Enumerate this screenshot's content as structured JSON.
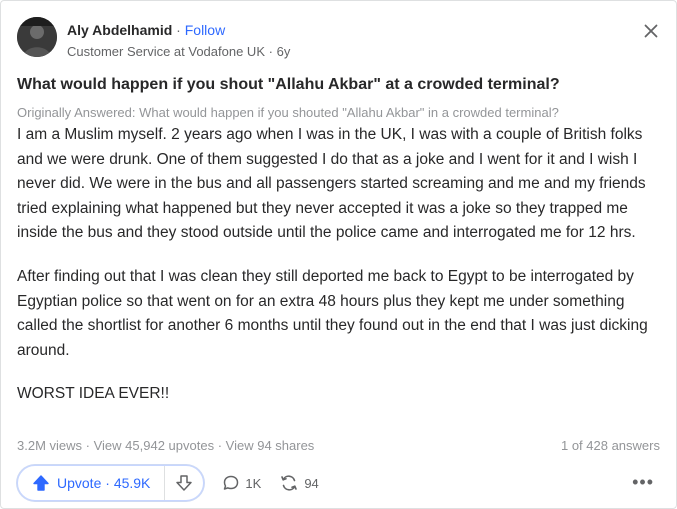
{
  "author": {
    "name": "Aly Abdelhamid",
    "separator": "·",
    "follow_label": "Follow",
    "credential": "Customer Service at Vodafone UK",
    "age": "6y"
  },
  "question": {
    "title": "What would happen if you shout \"Allahu Akbar\" at a crowded terminal?",
    "originally_answered": "Originally Answered: What would happen if you shouted \"Allahu Akbar\" in a crowded terminal?"
  },
  "answer": {
    "paragraphs": [
      "I am a Muslim myself. 2 years ago when I was in the UK, I was with a couple of British folks and we were drunk. One of them suggested I do that as a joke and I went for it and I wish I never did. We were in the bus and all passengers started screaming and me and my friends tried explaining what happened but they never accepted it was a joke so they trapped me inside the bus and they stood outside until the police came and interrogated me for 12 hrs.",
      "After finding out that I was clean they still deported me back to Egypt to be interrogated by Egyptian police so that went on for an extra 48 hours plus they kept me under something called the shortlist for another 6 months until they found out in the end that I was just dicking around.",
      "WORST IDEA EVER!!"
    ]
  },
  "stats": {
    "views": "3.2M views",
    "upvotes_link": "View 45,942 upvotes",
    "shares_link": "View 94 shares",
    "answer_position": "1 of 428 answers"
  },
  "actions": {
    "upvote_label": "Upvote",
    "upvote_count": "45.9K",
    "comments_count": "1K",
    "shares_count": "94"
  },
  "colors": {
    "accent": "#2e69ff",
    "text": "#282829",
    "muted": "#939598"
  }
}
